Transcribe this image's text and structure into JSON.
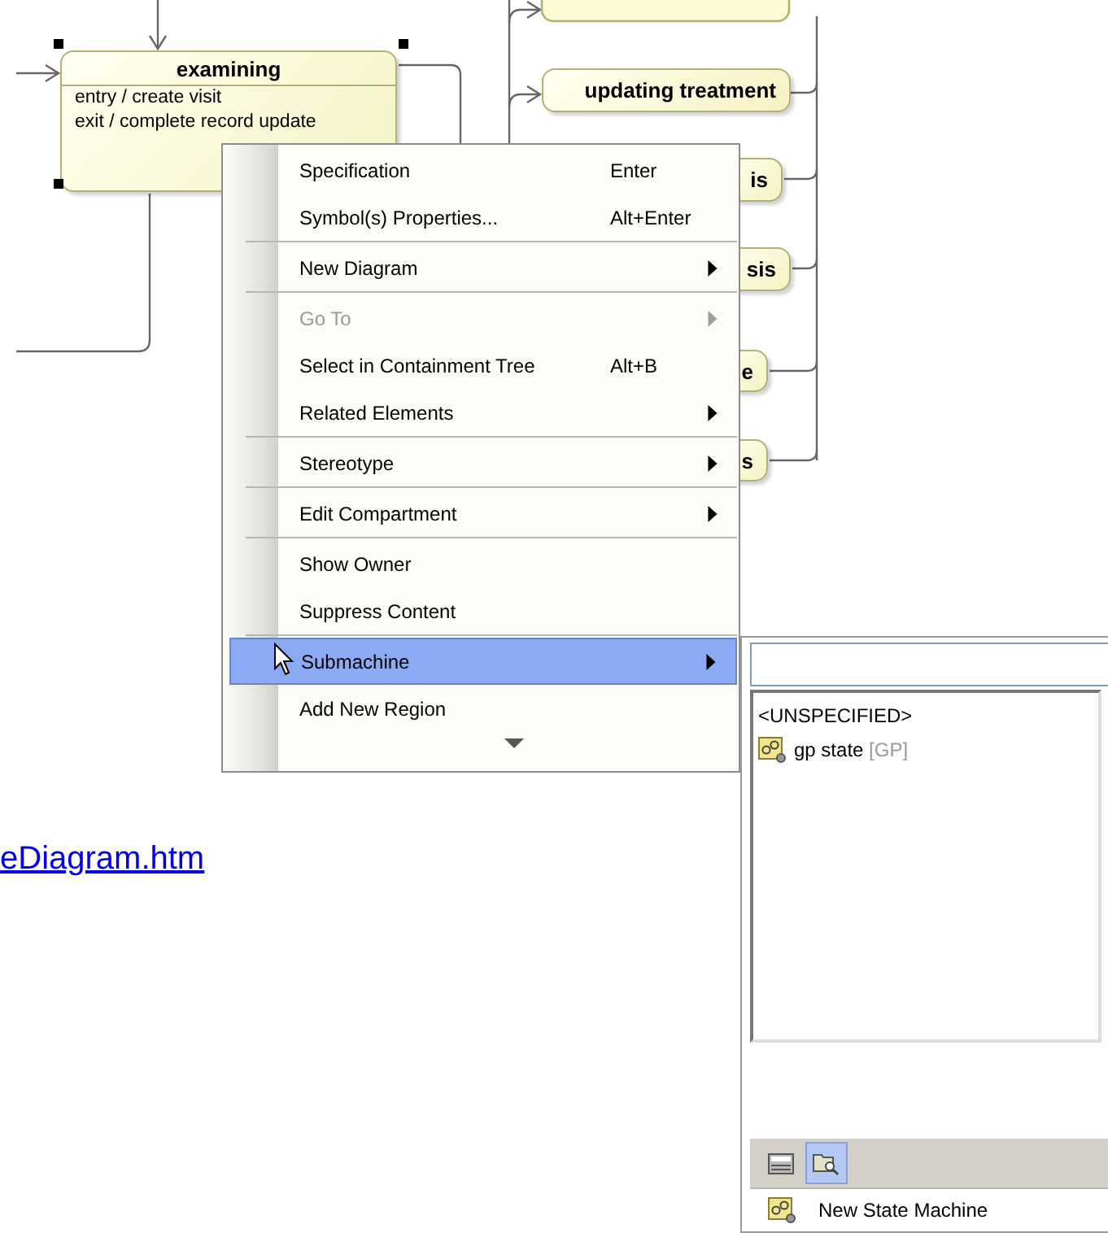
{
  "diagram": {
    "states": [
      {
        "name": "examining",
        "actions": [
          "entry / create visit",
          "exit / complete record update"
        ],
        "selected": true
      },
      {
        "name": "updating treatment",
        "selected": false
      },
      {
        "name": "is",
        "selected": false
      },
      {
        "name": "sis",
        "selected": false
      },
      {
        "name": "e",
        "selected": false
      },
      {
        "name": "s",
        "selected": false
      }
    ]
  },
  "context_menu": {
    "items": [
      {
        "label": "Specification",
        "shortcut": "Enter",
        "submenu": false,
        "disabled": false,
        "selected": false,
        "separator_after": false
      },
      {
        "label": "Symbol(s) Properties...",
        "shortcut": "Alt+Enter",
        "submenu": false,
        "disabled": false,
        "selected": false,
        "separator_after": true
      },
      {
        "label": "New Diagram",
        "submenu": true,
        "disabled": false,
        "selected": false,
        "separator_after": true
      },
      {
        "label": "Go To",
        "submenu": true,
        "disabled": true,
        "selected": false,
        "separator_after": false
      },
      {
        "label": "Select in Containment Tree",
        "shortcut": "Alt+B",
        "submenu": false,
        "disabled": false,
        "selected": false,
        "separator_after": false
      },
      {
        "label": "Related Elements",
        "submenu": true,
        "disabled": false,
        "selected": false,
        "separator_after": true
      },
      {
        "label": "Stereotype",
        "submenu": true,
        "disabled": false,
        "selected": false,
        "separator_after": true
      },
      {
        "label": "Edit Compartment",
        "submenu": true,
        "disabled": false,
        "selected": false,
        "separator_after": true
      },
      {
        "label": "Show Owner",
        "submenu": false,
        "disabled": false,
        "selected": false,
        "separator_after": false
      },
      {
        "label": "Suppress Content",
        "submenu": false,
        "disabled": false,
        "selected": false,
        "separator_after": true
      },
      {
        "label": "Submachine",
        "submenu": true,
        "disabled": false,
        "selected": true,
        "separator_after": false
      },
      {
        "label": "Add New Region",
        "submenu": false,
        "disabled": false,
        "selected": false,
        "separator_after": false
      }
    ],
    "more_below": true
  },
  "submachine_chooser": {
    "list": [
      {
        "kind": "text",
        "label": "<UNSPECIFIED>"
      },
      {
        "kind": "state-machine",
        "label": "gp state",
        "tag": "[GP]"
      }
    ],
    "toolbar": [
      {
        "kind": "list-view",
        "selected": false
      },
      {
        "kind": "browse",
        "selected": true
      }
    ],
    "footer": {
      "label": "New State Machine"
    }
  },
  "link": {
    "text": "eDiagram.htm"
  }
}
